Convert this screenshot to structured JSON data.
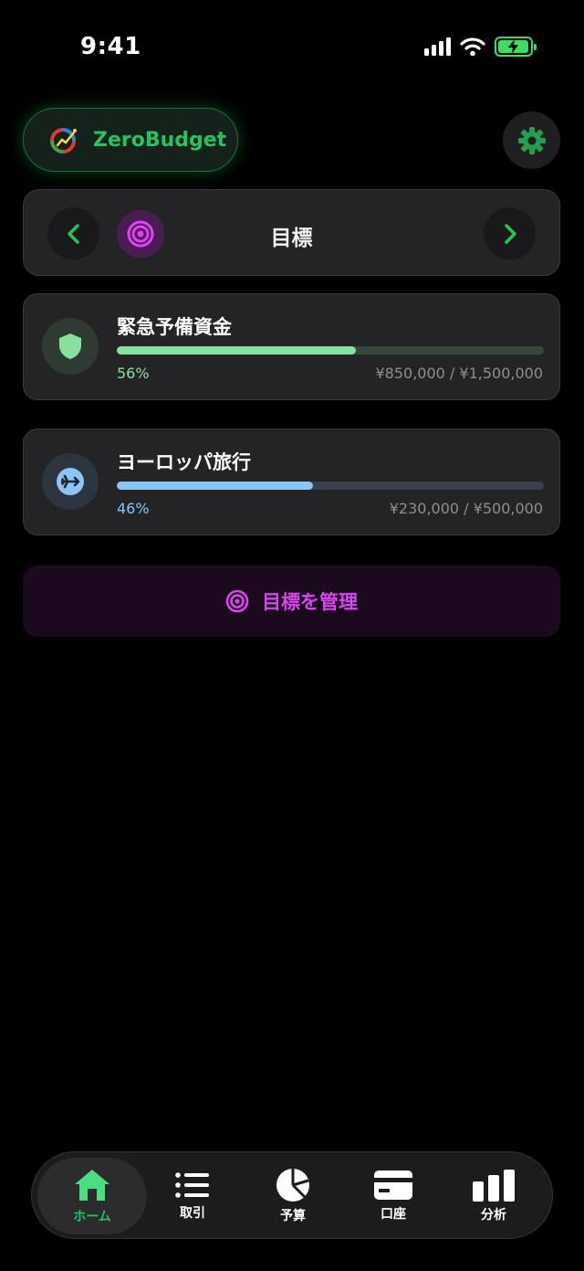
{
  "status_bar": {
    "time": "9:41"
  },
  "header": {
    "app_name": "ZeroBudget"
  },
  "switcher": {
    "title": "目標"
  },
  "goals": [
    {
      "name": "緊急予備資金",
      "percent": "56%",
      "progress": 0.56,
      "amount": "¥850,000 / ¥1,500,000",
      "icon": "shield-icon",
      "color": "#86e0a0"
    },
    {
      "name": "ヨーロッパ旅行",
      "percent": "46%",
      "progress": 0.46,
      "amount": "¥230,000 / ¥500,000",
      "icon": "airplane-icon",
      "color": "#8cc4f5"
    }
  ],
  "manage_button": {
    "label": "目標を管理"
  },
  "tabs": [
    {
      "label": "ホーム",
      "icon": "home-icon",
      "active": true
    },
    {
      "label": "取引",
      "icon": "list-icon",
      "active": false
    },
    {
      "label": "予算",
      "icon": "pie-chart-icon",
      "active": false
    },
    {
      "label": "口座",
      "icon": "card-icon",
      "active": false
    },
    {
      "label": "分析",
      "icon": "bar-chart-icon",
      "active": false
    }
  ],
  "colors": {
    "accent": "#22c55e",
    "goal_accent": "#d946ef",
    "background": "#000000"
  }
}
